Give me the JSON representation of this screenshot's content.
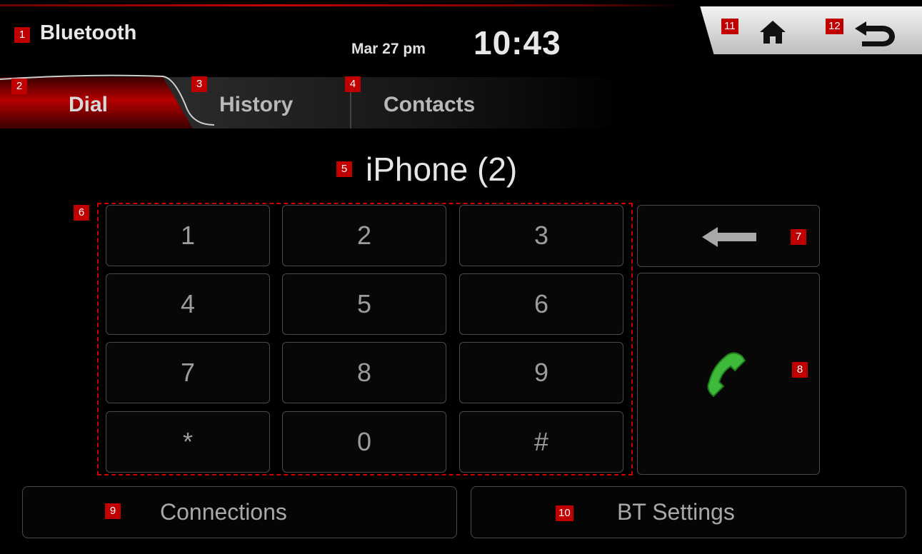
{
  "header": {
    "title": "Bluetooth",
    "date": "Mar 27 pm",
    "time": "10:43",
    "home_icon": "home-icon",
    "back_icon": "back-arrow-icon"
  },
  "tabs": [
    {
      "label": "Dial",
      "active": true
    },
    {
      "label": "History",
      "active": false
    },
    {
      "label": "Contacts",
      "active": false
    }
  ],
  "device_name": "iPhone (2)",
  "keypad": {
    "keys": [
      "1",
      "2",
      "3",
      "4",
      "5",
      "6",
      "7",
      "8",
      "9",
      "*",
      "0",
      "#"
    ]
  },
  "actions": {
    "backspace_icon": "backspace-arrow-icon",
    "call_icon": "phone-call-icon",
    "call_color": "#3fb93a"
  },
  "bottom": {
    "connections_label": "Connections",
    "bt_settings_label": "BT Settings"
  },
  "badges": [
    "1",
    "2",
    "3",
    "4",
    "5",
    "6",
    "7",
    "8",
    "9",
    "10",
    "11",
    "12"
  ],
  "colors": {
    "accent": "#c40000",
    "badge": "#c00000",
    "background": "#000000"
  }
}
